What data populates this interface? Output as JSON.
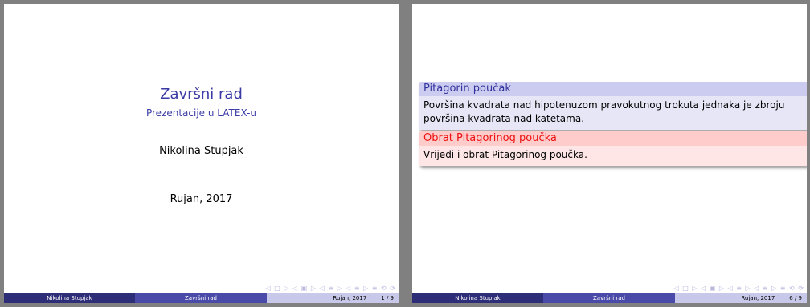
{
  "slides": [
    {
      "title": "Završni rad",
      "subtitle": "Prezentacije u LATEX-u",
      "author": "Nikolina Stupjak",
      "date": "Rujan, 2017",
      "footer": {
        "author": "Nikolina Stupjak",
        "title": "Završni rad",
        "date": "Rujan, 2017",
        "page": "1 / 9"
      }
    },
    {
      "blocks": [
        {
          "title": "Pitagorin poučak",
          "body": "Površina kvadrata nad hipotenuzom pravokutnog trokuta jednaka je zbroju površina kvadrata nad katetama."
        },
        {
          "title": "Obrat Pitagorinog poučka",
          "body": "Vrijedi i obrat Pitagorinog poučka."
        }
      ],
      "footer": {
        "author": "Nikolina Stupjak",
        "title": "Završni rad",
        "date": "Rujan, 2017",
        "page": "6 / 9"
      }
    }
  ],
  "nav_symbols": "◁ □ ▷ ◁ ▣ ▷ ◁ ≡ ▷ ◁ ≡ ▷ ≡ ⟲ ⟳",
  "colors": {
    "theme_blue": "#3b3ba6",
    "alert_red": "#ee1111",
    "foot_dark": "#2d2d78",
    "foot_mid": "#4a4aa8",
    "foot_light": "#c8c8ea"
  }
}
